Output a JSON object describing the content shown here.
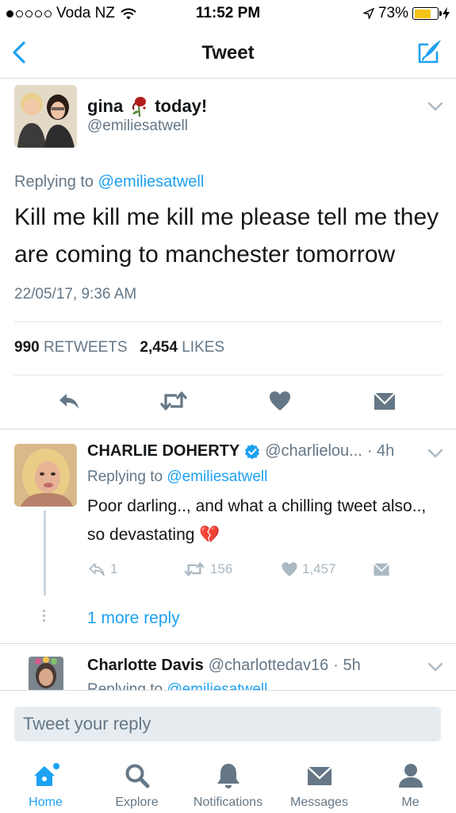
{
  "status_bar": {
    "carrier": "Voda NZ",
    "time": "11:52 PM",
    "battery": "73%",
    "battery_level": 0.73,
    "signal_bars_filled": 1,
    "signal_bars_total": 5
  },
  "nav": {
    "title": "Tweet"
  },
  "main_tweet": {
    "display_name": "gina",
    "name_suffix": "today!",
    "handle": "@emiliesatwell",
    "replying_prefix": "Replying to",
    "replying_handle": "@emiliesatwell",
    "text": "Kill me kill me kill me please tell me they are coming to manchester tomorrow",
    "timestamp": "22/05/17, 9:36 AM",
    "retweets_count": "990",
    "retweets_label": "RETWEETS",
    "likes_count": "2,454",
    "likes_label": "LIKES"
  },
  "replies": [
    {
      "display_name": "CHARLIE DOHERTY",
      "verified": true,
      "handle": "@charlielou...",
      "age": "· 4h",
      "replying_prefix": "Replying to",
      "replying_handle": "@emiliesatwell",
      "text": "Poor darling.., and what a chilling tweet also.., so devastating",
      "emoji": "💔",
      "reply_count": "1",
      "retweet_count": "156",
      "like_count": "1,457",
      "more_replies": "1 more reply"
    },
    {
      "display_name": "Charlotte Davis",
      "handle": "@charlottedav16",
      "age": "· 5h",
      "replying_prefix": "Replying to",
      "replying_handle": "@emiliesatwell"
    }
  ],
  "reply_bar": {
    "placeholder": "Tweet your reply"
  },
  "tabs": [
    {
      "label": "Home",
      "icon": "home-icon",
      "active": true
    },
    {
      "label": "Explore",
      "icon": "search-icon",
      "active": false
    },
    {
      "label": "Notifications",
      "icon": "bell-icon",
      "active": false
    },
    {
      "label": "Messages",
      "icon": "envelope-icon",
      "active": false
    },
    {
      "label": "Me",
      "icon": "person-icon",
      "active": false
    }
  ],
  "colors": {
    "accent": "#1da1f2",
    "muted": "#657786",
    "light_icon": "#aab8c2",
    "icon_dark": "#657786",
    "battery": "#f5c518"
  }
}
